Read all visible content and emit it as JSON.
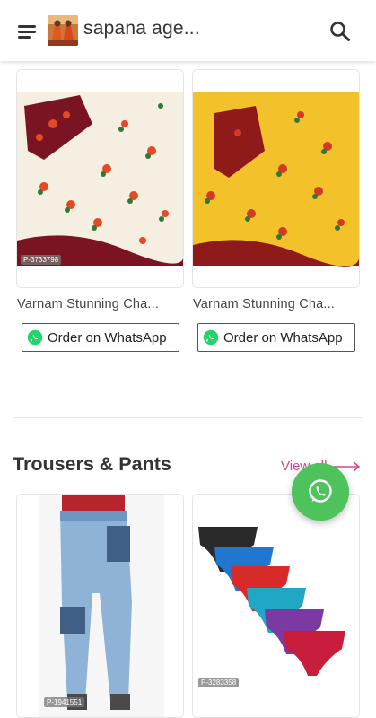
{
  "header": {
    "store_name": "sapana age...",
    "menu_icon": "hamburger-menu-icon",
    "search_icon": "search-icon"
  },
  "products_top": [
    {
      "title": "Varnam Stunning Cha...",
      "code": "P-3733798",
      "button_label": "Order on WhatsApp"
    },
    {
      "title": "Varnam Stunning Cha...",
      "code": "",
      "button_label": "Order on WhatsApp"
    }
  ],
  "section": {
    "title": "Trousers & Pants",
    "view_all_label": "View all"
  },
  "products_bottom": [
    {
      "code": "P-1941551"
    },
    {
      "code": "P-3283358"
    }
  ],
  "colors": {
    "whatsapp_green": "#4fc35b",
    "view_all_pink": "#d4478c",
    "saree_cream": "#f4efe0",
    "saree_yellow": "#f3c22a",
    "blouse_maroon": "#7a1422"
  }
}
